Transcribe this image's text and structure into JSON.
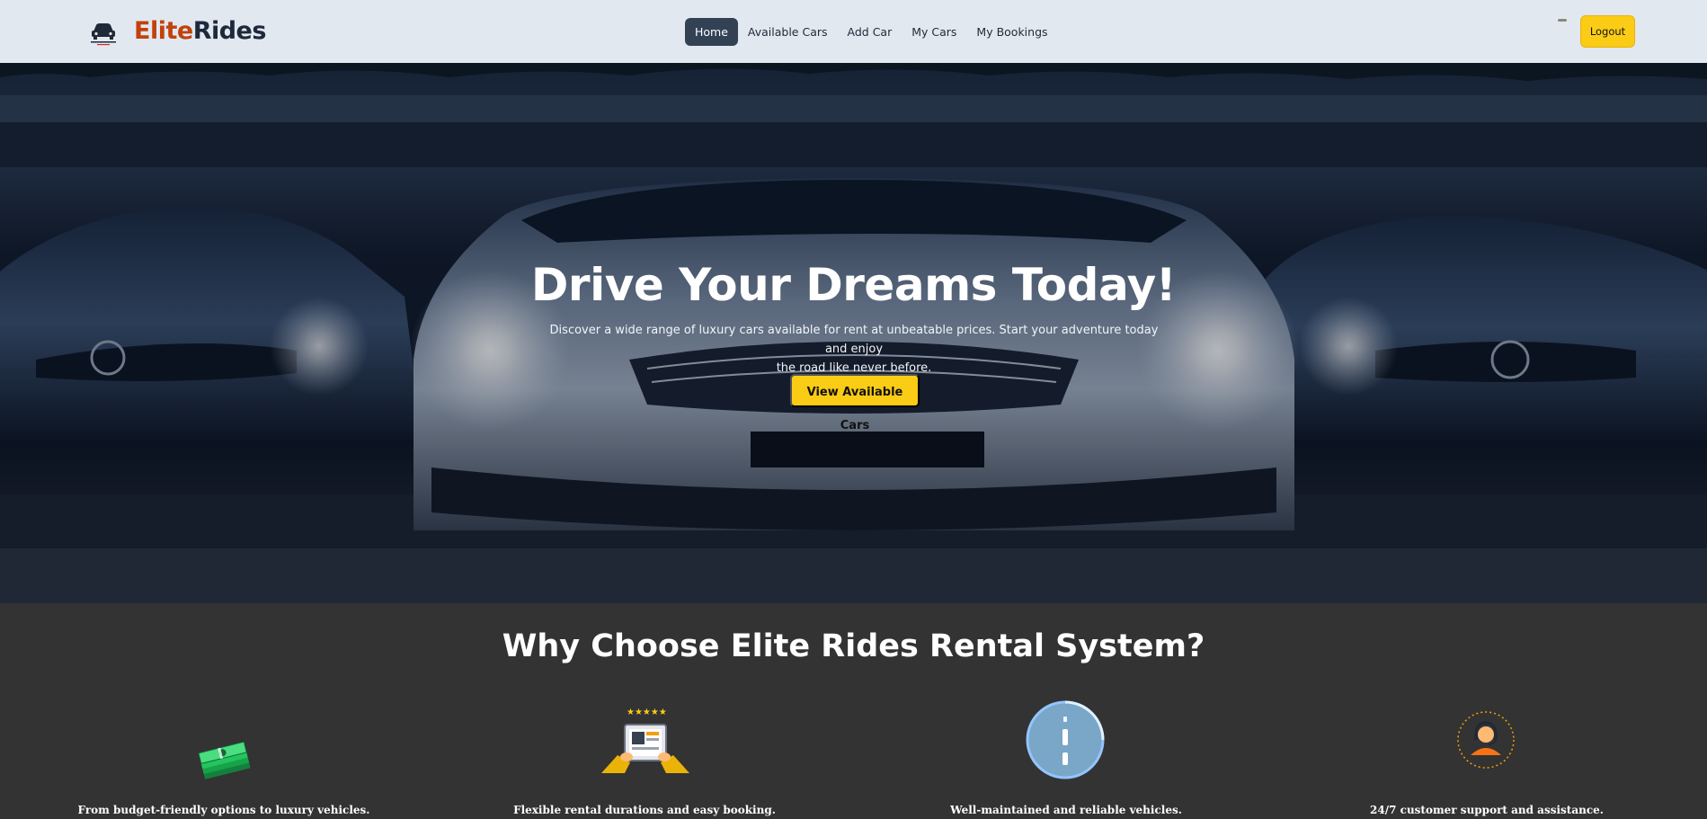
{
  "brand": {
    "part1": "Elite",
    "part2": "Rides",
    "logo_name": "auto-car-logo"
  },
  "nav": {
    "items": [
      {
        "label": "Home",
        "active": true
      },
      {
        "label": "Available Cars",
        "active": false
      },
      {
        "label": "Add Car",
        "active": false
      },
      {
        "label": "My Cars",
        "active": false
      },
      {
        "label": "My Bookings",
        "active": false
      }
    ],
    "logout_label": "Logout"
  },
  "hero": {
    "title": "Drive Your Dreams Today!",
    "subtitle_line1": "Discover a wide range of luxury cars available for rent at unbeatable prices. Start your adventure today and enjoy",
    "subtitle_line2": "the road like never before.",
    "cta_label": "View Available Cars"
  },
  "why": {
    "title": "Why Choose Elite Rides Rental System?",
    "features": [
      {
        "icon": "money-stack-icon",
        "text": "From budget-friendly options to luxury vehicles."
      },
      {
        "icon": "booking-tablet-icon",
        "text": "Flexible rental durations and easy booking."
      },
      {
        "icon": "road-icon",
        "text": "Well-maintained and reliable vehicles."
      },
      {
        "icon": "support-agent-icon",
        "text": "24/7 customer support and assistance."
      }
    ]
  },
  "colors": {
    "nav_bg": "#e2e8f0",
    "brand_accent": "#c2410c",
    "brand_dark": "#1e293b",
    "active_nav": "#334155",
    "cta_yellow": "#facc15",
    "section_bg": "#333333"
  }
}
